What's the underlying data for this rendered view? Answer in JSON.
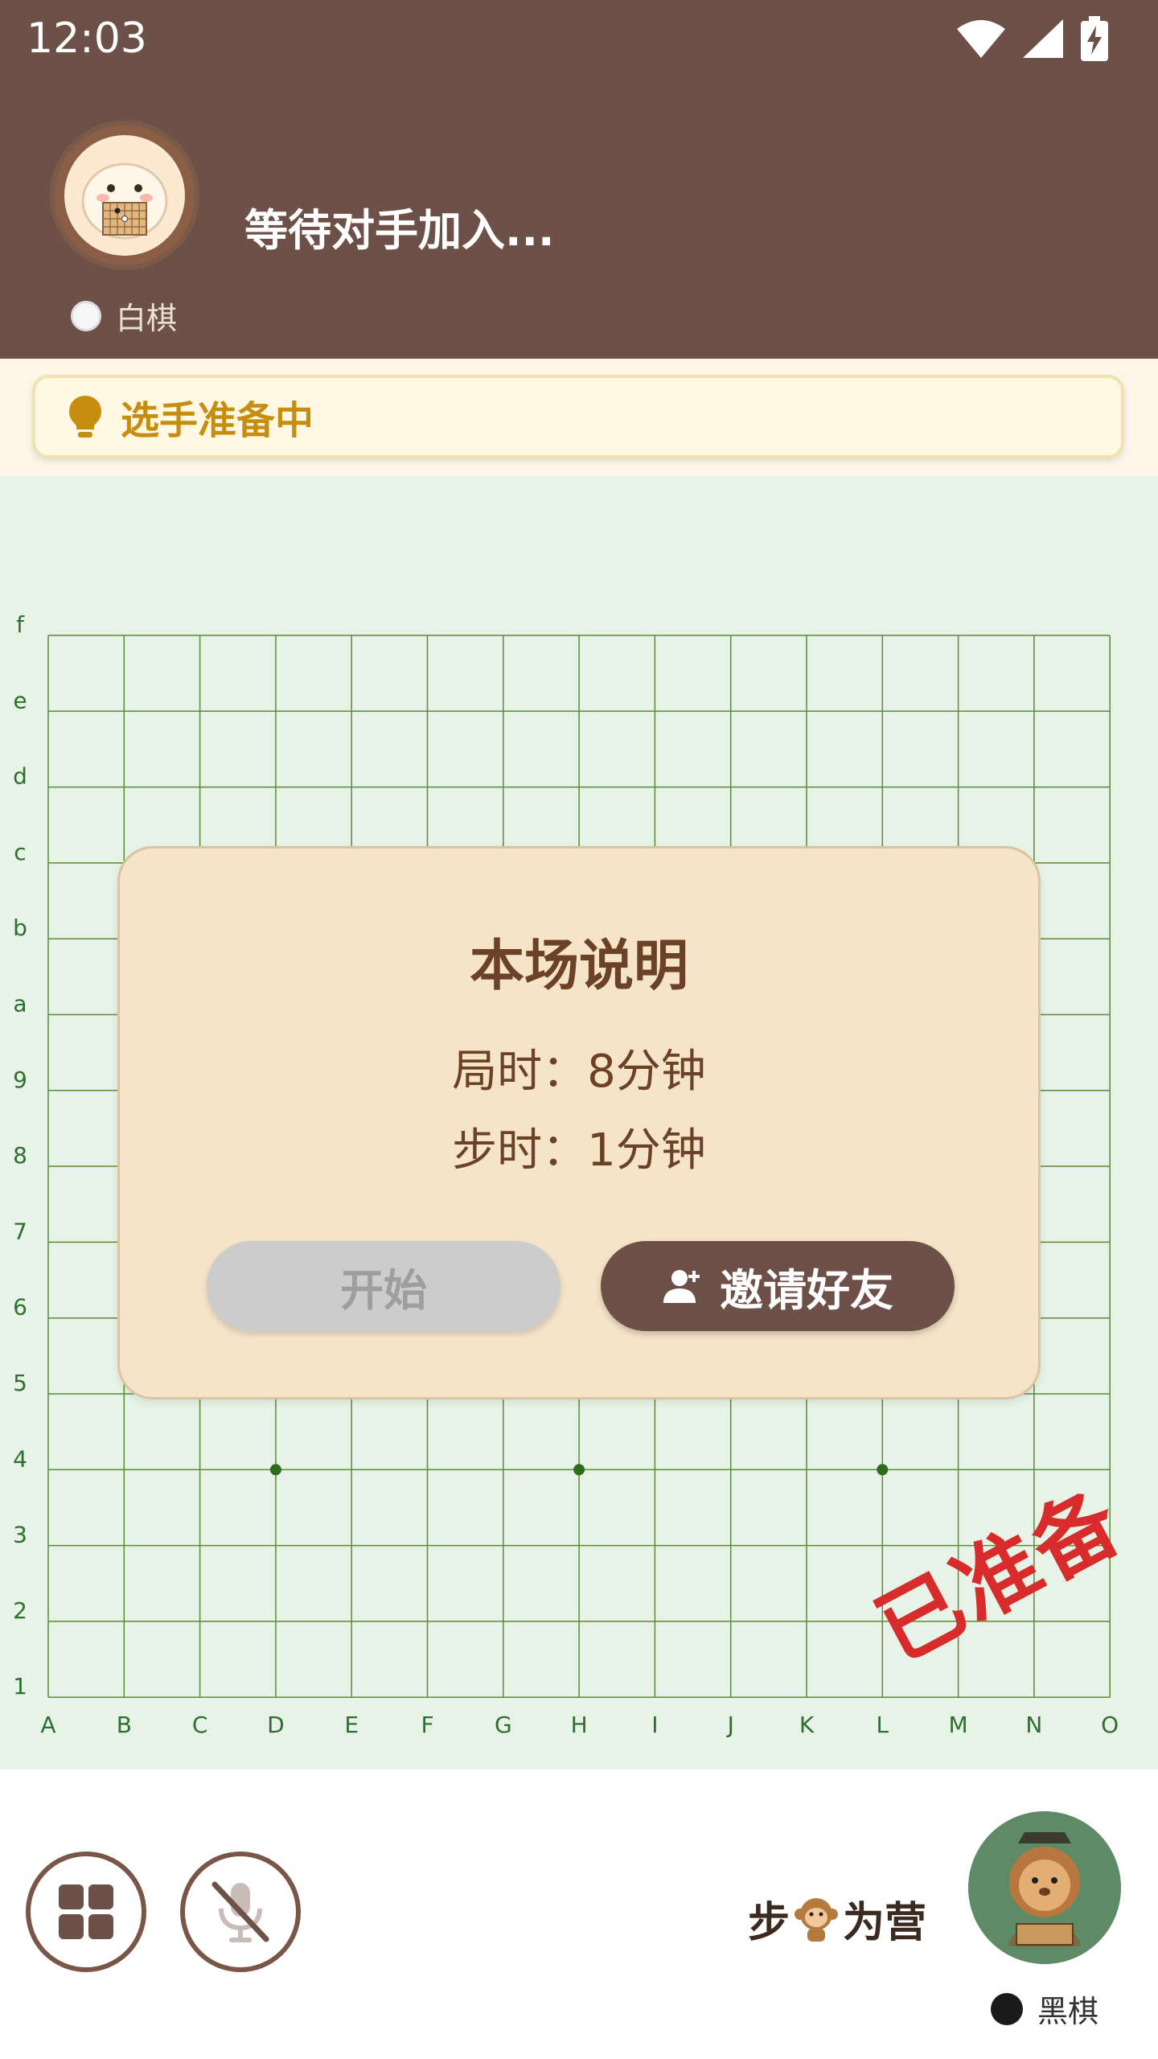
{
  "status_bar": {
    "time": "12:03"
  },
  "opponent": {
    "status_text": "等待对手加入...",
    "role_label": "白棋"
  },
  "notice": {
    "text": "选手准备中"
  },
  "board": {
    "row_labels": [
      "f",
      "e",
      "d",
      "c",
      "b",
      "a",
      "9",
      "8",
      "7",
      "6",
      "5",
      "4",
      "3",
      "2",
      "1"
    ],
    "col_labels": [
      "A",
      "B",
      "C",
      "D",
      "E",
      "F",
      "G",
      "H",
      "I",
      "J",
      "K",
      "L",
      "M",
      "N",
      "O"
    ],
    "star_points": [
      "D4",
      "H4",
      "L4"
    ],
    "line_color": "#5b8a3a",
    "label_color": "#2e6e2e"
  },
  "dialog": {
    "title": "本场说明",
    "game_time": "局时：8分钟",
    "move_time": "步时：1分钟",
    "start_label": "开始",
    "invite_label": "邀请好友"
  },
  "ready_stamp": "已准备",
  "player": {
    "brand_left": "步",
    "brand_right": "为营",
    "role_label": "黑棋"
  },
  "colors": {
    "header_brown": "#6d5148",
    "notice_text": "#c68d10",
    "board_bg": "#e6f3e6",
    "dialog_bg": "#f5e4c8",
    "stamp_red": "#d82b2b"
  }
}
